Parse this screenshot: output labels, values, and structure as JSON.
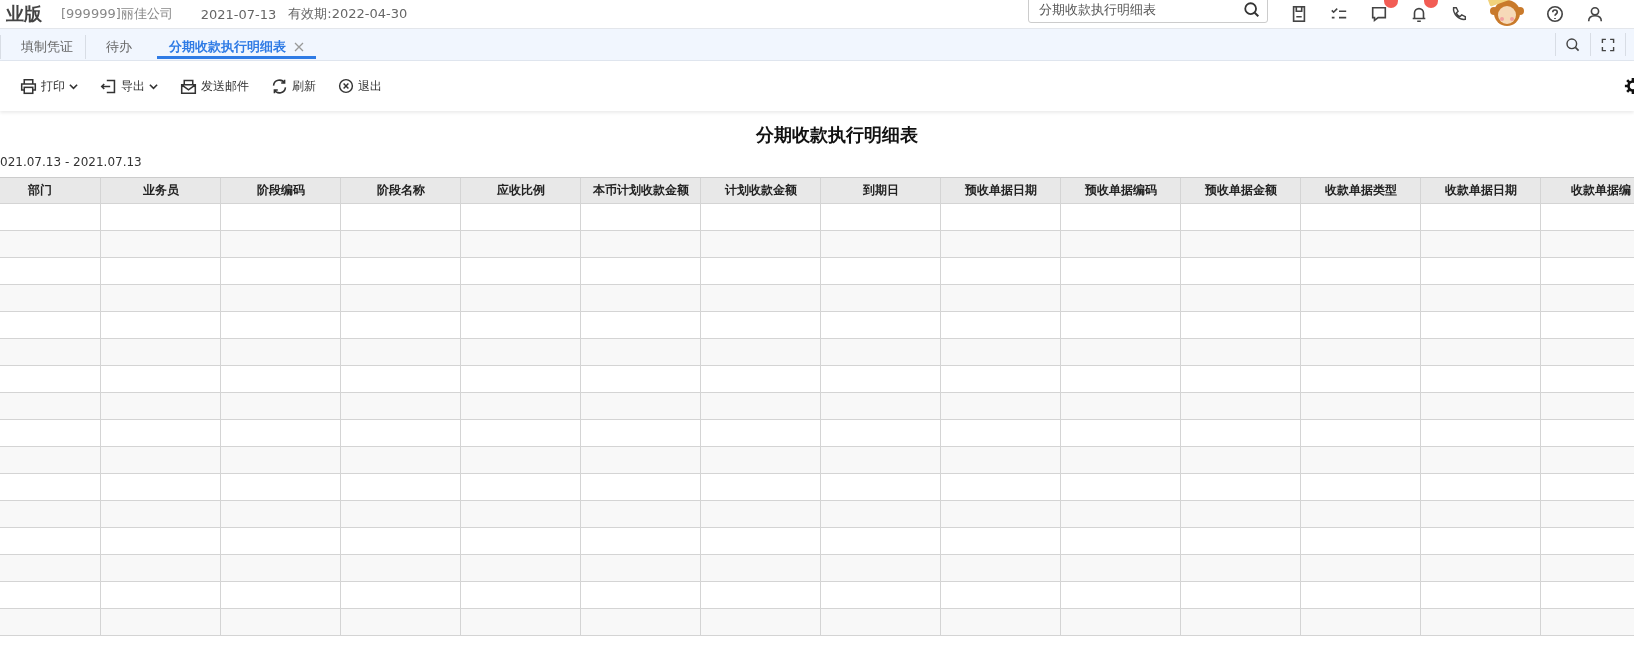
{
  "header": {
    "product": "业版",
    "company": "[999999]丽佳公司",
    "date": "2021-07-13",
    "validity": "有效期:2022-04-30",
    "search": {
      "value": "分期收款执行明细表"
    },
    "icons": [
      {
        "kind": "save",
        "badge": false
      },
      {
        "kind": "tasks",
        "badge": false
      },
      {
        "kind": "chat",
        "badge": true
      },
      {
        "kind": "bell",
        "badge": true
      },
      {
        "kind": "phone",
        "badge": false
      },
      {
        "kind": "mascot",
        "badge": false
      },
      {
        "kind": "help",
        "badge": false
      },
      {
        "kind": "user",
        "badge": false
      }
    ]
  },
  "tabs": [
    {
      "label": "填制凭证",
      "selected": false,
      "closable": false
    },
    {
      "label": "待办",
      "selected": false,
      "closable": false
    },
    {
      "label": "分期收款执行明细表",
      "selected": true,
      "closable": true
    }
  ],
  "toolbar": [
    {
      "kind": "print",
      "label": "打印",
      "dropdown": true
    },
    {
      "kind": "export",
      "label": "导出",
      "dropdown": true
    },
    {
      "kind": "mail",
      "label": "发送邮件",
      "dropdown": false
    },
    {
      "kind": "refresh",
      "label": "刷新",
      "dropdown": false
    },
    {
      "kind": "exit",
      "label": "退出",
      "dropdown": false
    }
  ],
  "report": {
    "title": "分期收款执行明细表",
    "date_range": "021.07.13 - 2021.07.13",
    "columns": [
      "部门",
      "业务员",
      "阶段编码",
      "阶段名称",
      "应收比例",
      "本币计划收款金额",
      "计划收款金额",
      "到期日",
      "预收单据日期",
      "预收单据编码",
      "预收单据金额",
      "收款单据类型",
      "收款单据日期",
      "收款单据编"
    ]
  }
}
